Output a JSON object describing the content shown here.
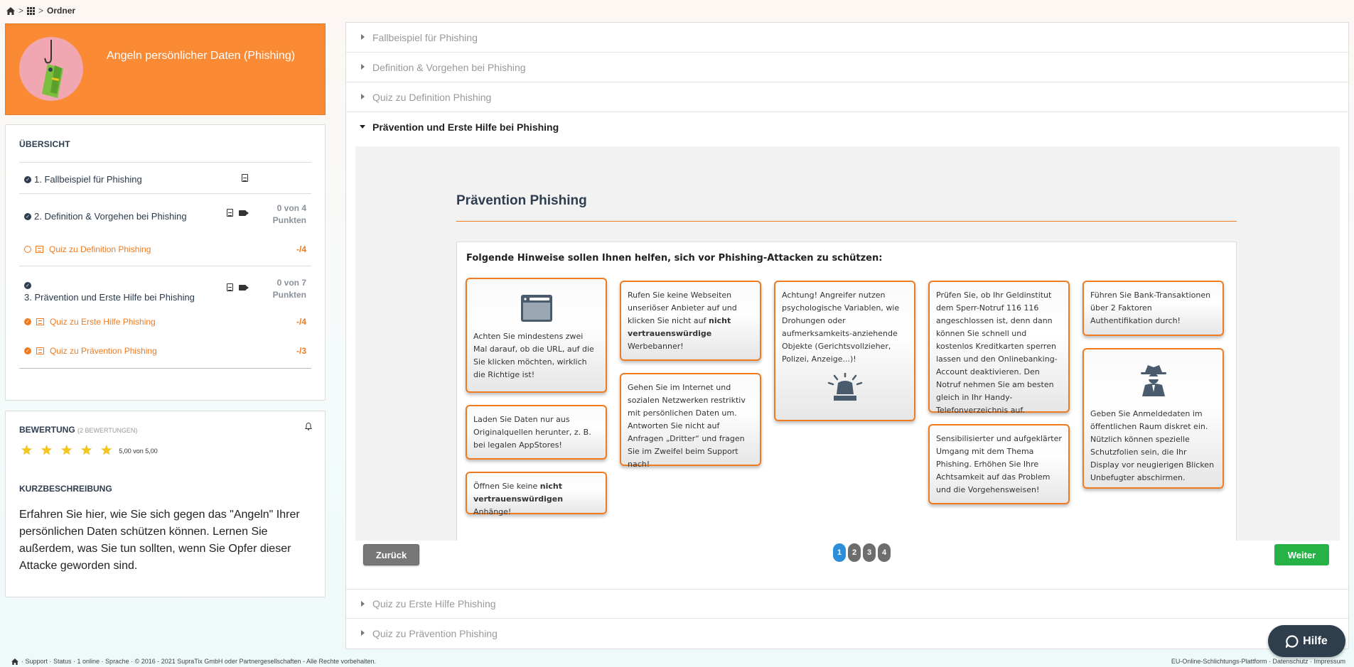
{
  "breadcrumb": {
    "current": "Ordner",
    "sep1": ">",
    "sep2": ">"
  },
  "course": {
    "title": "Angeln persönlicher Daten (Phishing)"
  },
  "overview": {
    "title": "ÜBERSICHT",
    "items": [
      {
        "label": "1. Fallbeispiel für Phishing"
      },
      {
        "label": "2. Definition & Vorgehen bei Phishing",
        "points": "0 von 4",
        "points_unit": "Punkten"
      },
      {
        "label": "Quiz zu Definition Phishing",
        "score": "-/4"
      },
      {
        "label": "3. Prävention und Erste Hilfe bei Phishing",
        "points": "0 von 7",
        "points_unit": "Punkten"
      },
      {
        "label": "Quiz zu Erste Hilfe Phishing",
        "score": "-/4"
      },
      {
        "label": "Quiz zu Prävention Phishing",
        "score": "-/3"
      }
    ]
  },
  "rating": {
    "title": "BEWERTUNG",
    "count": "(2 BEWERTUNGEN)",
    "stars_text": "5,00 von 5,00",
    "stars_value": 5,
    "short_title": "KURZBESCHREIBUNG",
    "short_desc": "Erfahren Sie hier, wie Sie sich gegen das \"Angeln\" Ihrer persönlichen Daten schützen können. Lernen Sie außerdem, was Sie tun sollten, wenn Sie Opfer dieser Attacke geworden sind."
  },
  "accordion": {
    "sections": [
      {
        "label": "Fallbeispiel für Phishing"
      },
      {
        "label": "Definition & Vorgehen bei Phishing"
      },
      {
        "label": "Quiz zu Definition Phishing"
      },
      {
        "label": "Prävention und Erste Hilfe bei Phishing"
      },
      {
        "label": "Quiz zu Erste Hilfe Phishing"
      },
      {
        "label": "Quiz zu Prävention Phishing"
      }
    ]
  },
  "content": {
    "title": "Prävention Phishing",
    "intro": "Folgende Hinweise sollen Ihnen helfen, sich vor Phishing-Attacken zu schützen:",
    "tips": {
      "url_check": "Achten Sie mindestens zwei Mal darauf, ob die URL, auf die Sie klicken möchten, wirklich die Richtige ist!",
      "download_pre": "Laden Sie Daten nur aus Originalquellen herunter, z. B. bei legalen AppStores!",
      "attach_pre": "Öffnen Sie keine ",
      "attach_bold": "nicht vertrauenswürdigen",
      "attach_post": " Anhänge!",
      "web_pre": "Rufen Sie keine Webseiten unseriöser Anbieter auf und klicken Sie nicht auf ",
      "web_bold": "nicht vertrauenswürdige",
      "web_post": " Werbebanner!",
      "social": "Gehen Sie im Internet und sozialen Netzwerken restriktiv mit persönlichen Daten um. Antworten Sie nicht auf Anfragen „Dritter“ und fragen Sie im Zweifel beim Support nach!",
      "psych": "Achtung! Angreifer nutzen psychologische Variablen, wie Drohungen oder aufmerksamkeits-anziehende Objekte (Gerichtsvollzieher, Polizei, Anzeige...)!",
      "bank": "Prüfen Sie, ob Ihr Geldinstitut dem Sperr-Notruf 116 116 angeschlossen ist, denn dann können Sie schnell und kostenlos Kreditkarten sperren lassen und den Onlinebanking-Account deaktivieren. Den Notruf nehmen Sie am besten gleich in Ihr Handy-Telefonverzeichnis auf.",
      "aware": "Sensibilisierter und aufgeklärter Umgang mit dem Thema Phishing. Erhöhen Sie Ihre Achtsamkeit auf das Problem und die Vorgehensweisen!",
      "twofa": "Führen Sie Bank-Transaktionen über 2 Faktoren Authentifikation durch!",
      "login": "Geben Sie Anmeldedaten im öffentlichen Raum diskret ein. Nützlich können spezielle Schutzfolien sein, die Ihr Display vor neugierigen Blicken Unbefugter abschirmen."
    }
  },
  "nav": {
    "back": "Zurück",
    "next": "Weiter",
    "pages": [
      "1",
      "2",
      "3",
      "4"
    ],
    "current_page": 1
  },
  "footer": {
    "left": "· Support · Status · 1 online · Sprache · © 2016 - 2021 SupraTix GmbH oder Partnergesellschaften - Alle Rechte vorbehalten.",
    "right": "EU-Online-Schlichtungs-Plattform · Datenschutz · Impressum"
  },
  "help": {
    "label": "Hilfe"
  },
  "icons": [
    "home-icon",
    "apps-icon",
    "document-icon",
    "video-icon",
    "quiz-icon",
    "check-icon",
    "bell-icon",
    "star-icon",
    "browser-icon",
    "siren-icon",
    "spy-icon",
    "chat-icon"
  ],
  "colors": {
    "accent": "#fb8a35",
    "primary_dark": "#2e3d4f",
    "success": "#27b246",
    "page_active": "#2c8ed8"
  }
}
